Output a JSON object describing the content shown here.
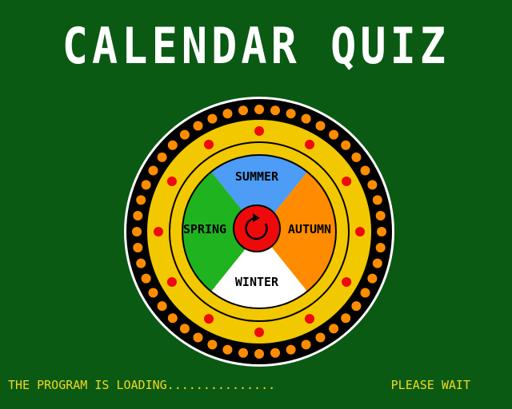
{
  "title": "CALENDAR QUIZ",
  "seasons": {
    "top": "SUMMER",
    "right": "AUTUMN",
    "bottom": "WINTER",
    "left": "SPRING"
  },
  "status": {
    "loading": "THE PROGRAM IS LOADING...............",
    "wait": "PLEASE WAIT"
  },
  "colors": {
    "background": "#0a5a14",
    "title": "#ffffff",
    "status_text": "#f2d820",
    "summer": "#4d9cf5",
    "autumn": "#ff8c00",
    "winter": "#ffffff",
    "spring": "#1fb31f",
    "ring_gold": "#f2c800",
    "ring_black": "#000000",
    "bead_orange": "#ff8c00",
    "dot_red": "#ee0a0a"
  },
  "icons": {
    "center": "spin-arrow-icon"
  }
}
